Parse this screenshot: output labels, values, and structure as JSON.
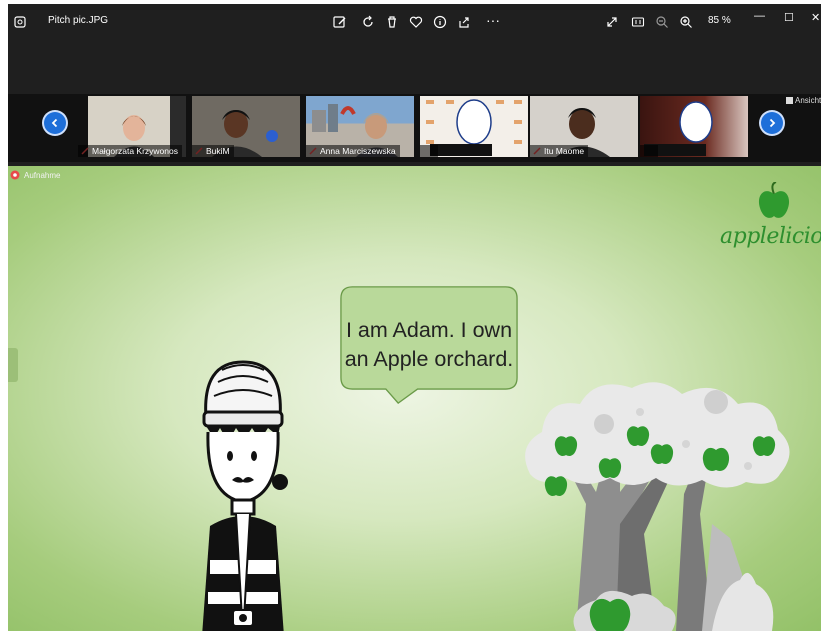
{
  "window": {
    "filename": "Pitch pic.JPG",
    "zoom": "85 %",
    "colors": {
      "titlebar": "#1f1f1f",
      "accent": "#1e6fd9"
    }
  },
  "toolbar": {
    "icons": [
      "edit-image-icon",
      "rotate-icon",
      "delete-icon",
      "favorite-icon",
      "info-icon",
      "share-icon",
      "more-icon"
    ],
    "more_label": "···"
  },
  "window_controls": {
    "minimize": "—",
    "maximize": "☐",
    "close": "✕"
  },
  "view_controls": [
    "fit-icon",
    "actual-size-icon",
    "zoom-out-icon",
    "zoom-in-icon"
  ],
  "meeting": {
    "view_label": "Ansicht",
    "participants": [
      {
        "name": "Małgorzata Krzywonos",
        "muted": true
      },
      {
        "name": "BukiM",
        "muted": true
      },
      {
        "name": "Anna Marciszewska",
        "muted": true
      },
      {
        "name": "",
        "muted": false
      },
      {
        "name": "Itu Maome",
        "muted": true
      },
      {
        "name": "",
        "muted": false
      }
    ],
    "recording_label": "Aufnahme"
  },
  "slide": {
    "brand": "applelicious",
    "speech_line1": "I am Adam. I own",
    "speech_line2": "an Apple orchard.",
    "colors": {
      "bubble": "#b9d99a",
      "bubble_border": "#6a9a48",
      "apple": "#2f9a2f",
      "tree_trunk": "#8e8e8e",
      "foliage": "#e9e9e9"
    }
  }
}
